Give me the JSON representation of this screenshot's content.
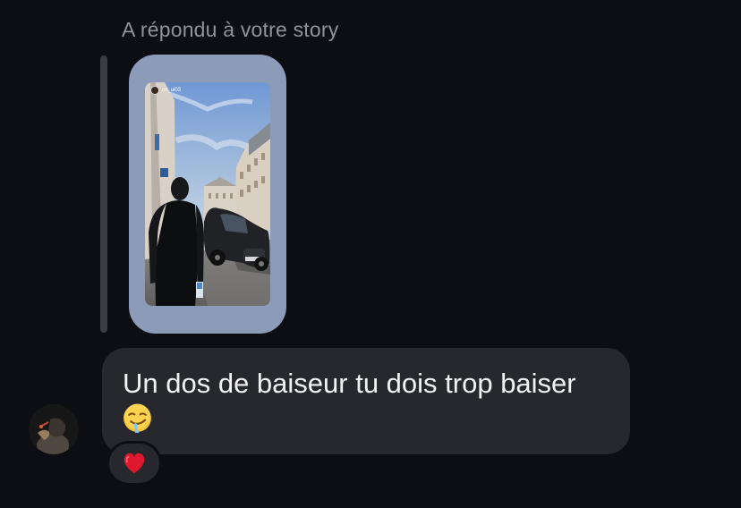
{
  "reply_caption": "A répondu à votre story",
  "story": {
    "username": "co_ui03",
    "image_description_icon": "story-photo",
    "card_color": "#8b9bb8"
  },
  "message": {
    "text": "Un dos de baiseur tu dois trop baiser",
    "emoji_name": "drooling-face-emoji"
  },
  "reaction": {
    "emoji_name": "red-heart-emoji",
    "color": "#e0182d"
  },
  "colors": {
    "background": "#0c0e13",
    "bubble": "#26282e",
    "caption": "#8f939c",
    "text": "#f3f3f4"
  }
}
